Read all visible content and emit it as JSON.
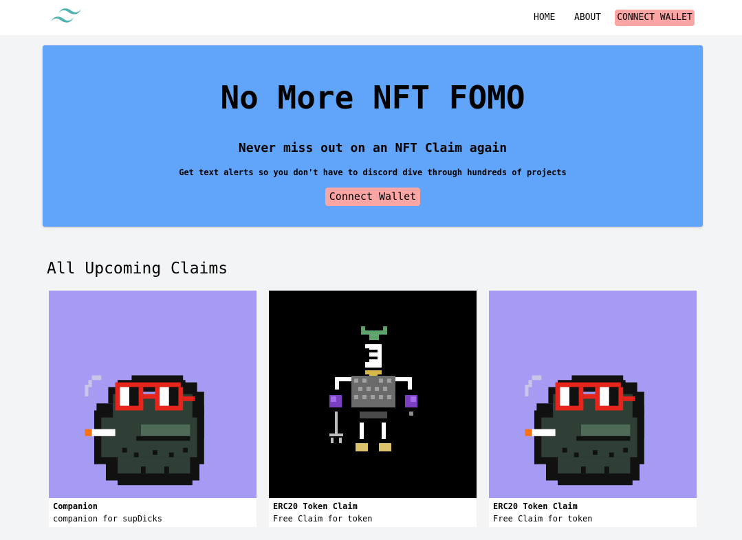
{
  "nav": {
    "logo_icon": "tailwind-wave-logo",
    "home": "HOME",
    "about": "ABOUT",
    "connect_wallet": "CONNECT WALLET"
  },
  "hero": {
    "title": "No More NFT FOMO",
    "subtitle": "Never miss out on an NFT Claim again",
    "description": "Get text alerts so you don't have to discord dive through hundreds of projects",
    "button": "Connect Wallet"
  },
  "claims": {
    "heading": "All Upcoming Claims",
    "cards": [
      {
        "title": "Companion",
        "description": "companion for supDicks",
        "image": "pixel-toad-red-glasses-icon"
      },
      {
        "title": "ERC20 Token Claim",
        "description": "Free Claim for token",
        "image": "pixel-robot-character-icon"
      },
      {
        "title": "ERC20 Token Claim",
        "description": "Free Claim for token",
        "image": "pixel-toad-red-glasses-icon"
      }
    ]
  },
  "colors": {
    "background": "#f3f4f6",
    "hero": "#60a5fa",
    "button": "#fca5a5",
    "card_purple": "#a59bf2",
    "card_black": "#000000",
    "logo": "#4fb3b2"
  }
}
